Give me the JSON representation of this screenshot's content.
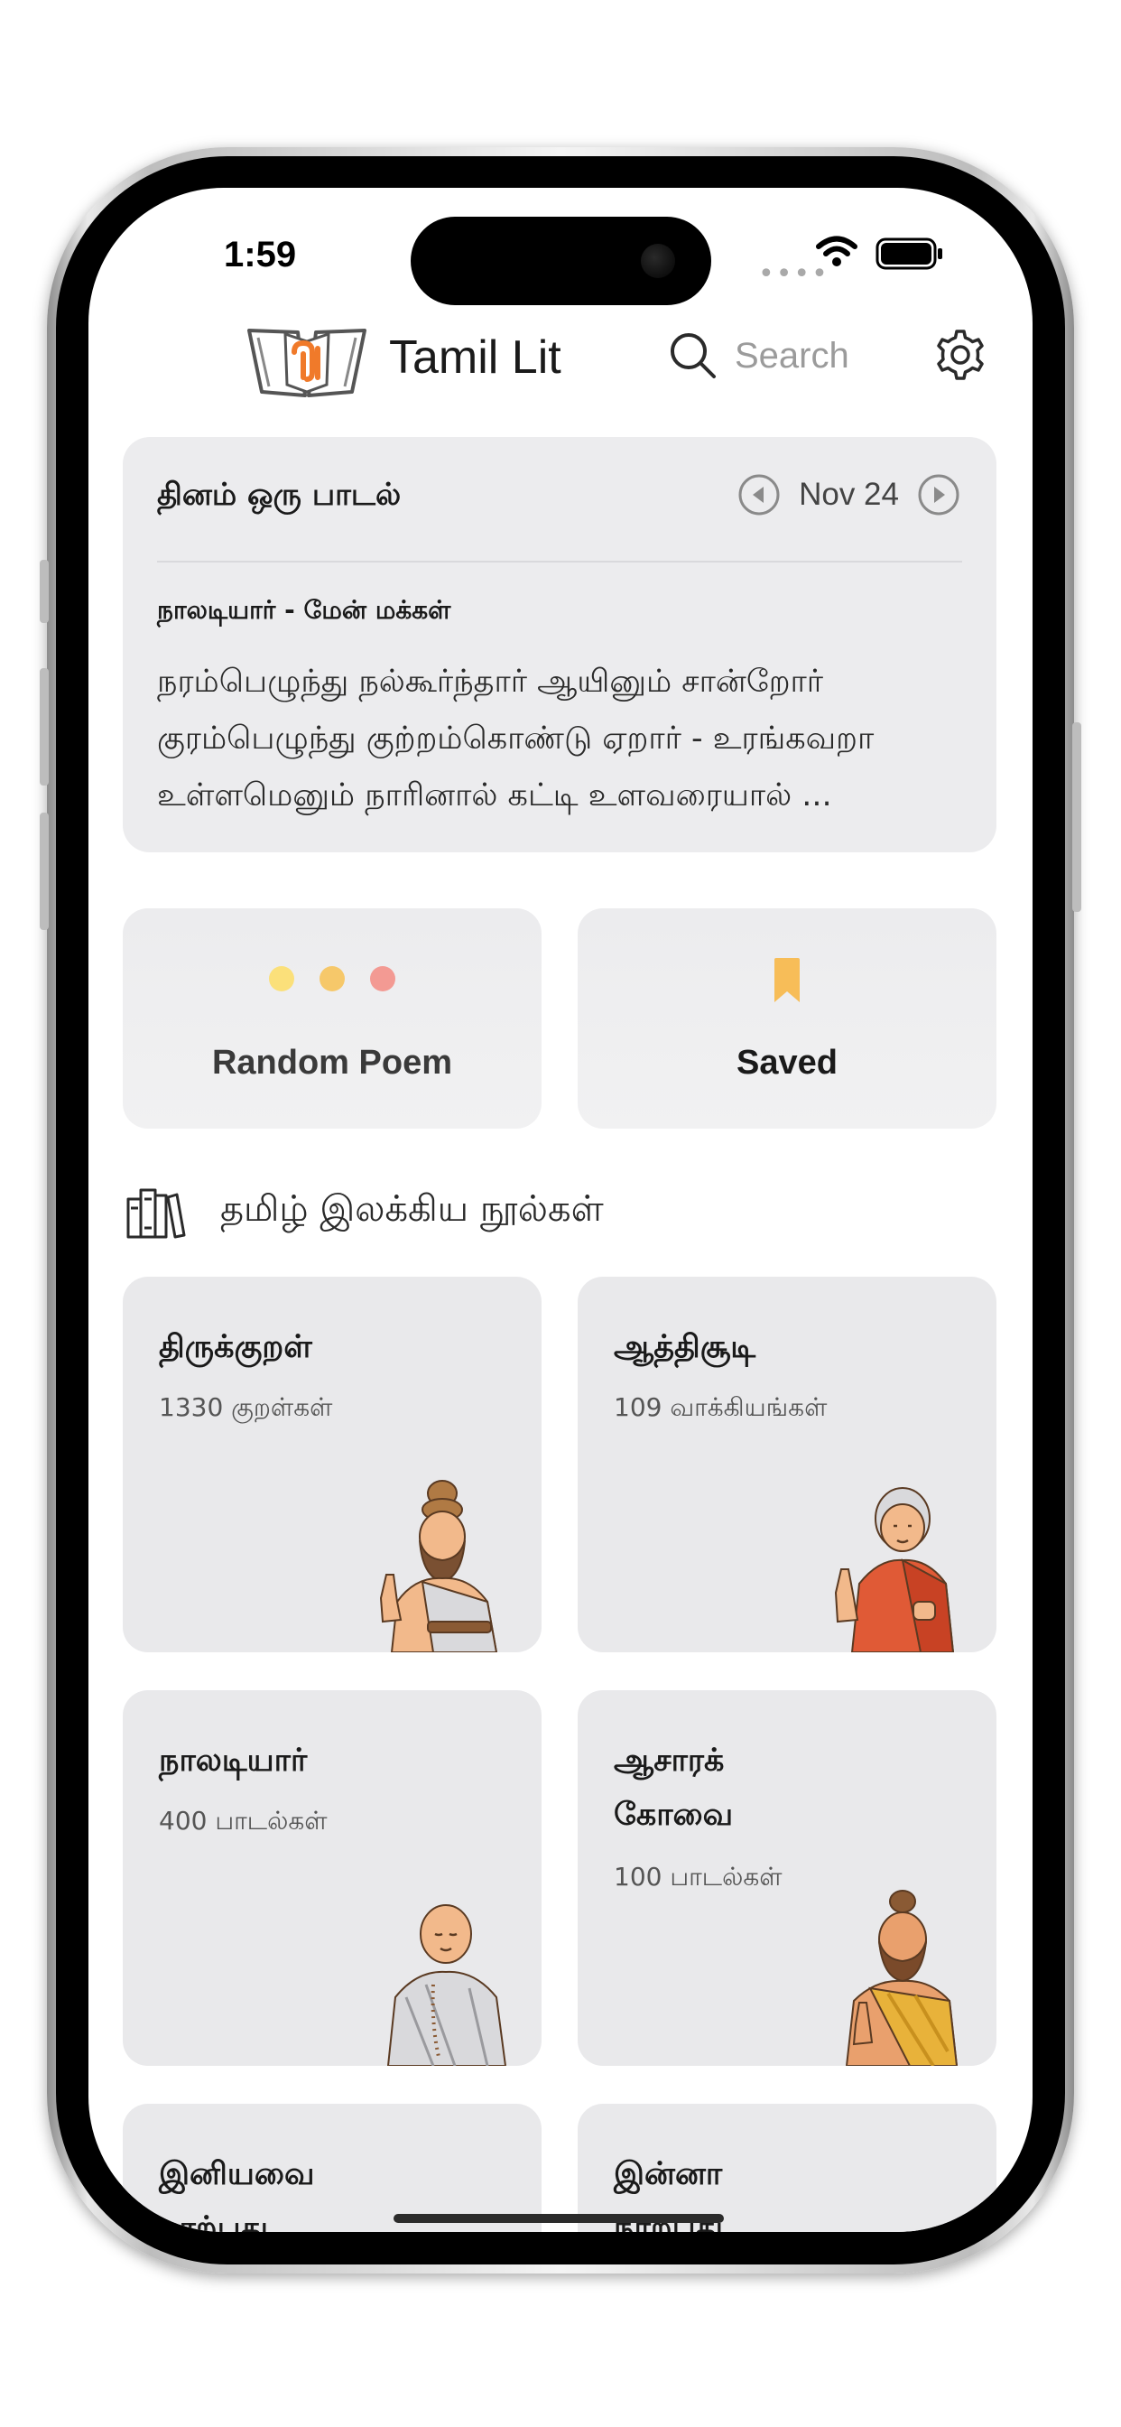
{
  "status_bar": {
    "time": "1:59"
  },
  "header": {
    "app_title": "Tamil Lit",
    "search_placeholder": "Search",
    "logo_icon": "book-logo-icon",
    "settings_icon": "gear-icon"
  },
  "daily_poem": {
    "heading": "தினம் ஒரு பாடல்",
    "date": "Nov 24",
    "source": "நாலடியார் - மேன் மக்கள்",
    "lines": [
      "நரம்பெழுந்து நல்கூர்ந்தார் ஆயினும் சான்றோர்",
      "குரம்பெழுந்து குற்றம்கொண்டு ஏறார் - உரங்கவறா",
      "உள்ளமெனும் நாரினால் கட்டி உளவரையால் ..."
    ]
  },
  "actions": {
    "random_label": "Random Poem",
    "saved_label": "Saved",
    "dot_colors": [
      "#fbe07a",
      "#f6c86a",
      "#f39a93"
    ],
    "bookmark_color": "#f7bd58"
  },
  "section": {
    "title": "தமிழ் இலக்கிய நூல்கள்"
  },
  "books": [
    {
      "title": "திருக்குறள்",
      "count": "1330 குறள்கள்"
    },
    {
      "title": "ஆத்திசூடி",
      "count": "109 வாக்கியங்கள்"
    },
    {
      "title": "நாலடியார்",
      "count": "400 பாடல்கள்"
    },
    {
      "title_line1": "ஆசாரக்",
      "title_line2": "கோவை",
      "count": "100 பாடல்கள்"
    },
    {
      "title_line1": "இனியவை",
      "title_line2": "நாற்பது"
    },
    {
      "title_line1": "இன்னா",
      "title_line2": "நாற்பது"
    }
  ]
}
